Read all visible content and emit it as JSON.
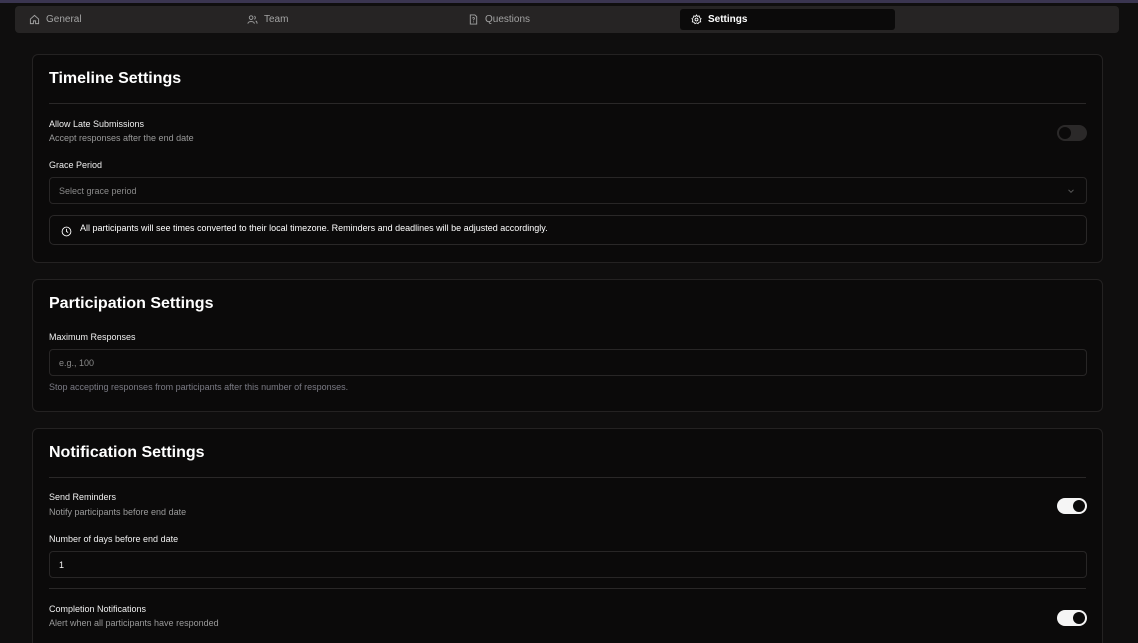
{
  "tabs": [
    {
      "label": "General",
      "icon": "home-icon",
      "active": false
    },
    {
      "label": "Team",
      "icon": "users-icon",
      "active": false
    },
    {
      "label": "Questions",
      "icon": "file-question-icon",
      "active": false
    },
    {
      "label": "Settings",
      "icon": "gear-icon",
      "active": true
    }
  ],
  "timeline": {
    "title": "Timeline Settings",
    "late": {
      "label": "Allow Late Submissions",
      "description": "Accept responses after the end date",
      "enabled": false
    },
    "grace": {
      "label": "Grace Period",
      "placeholder": "Select grace period"
    },
    "info": "All participants will see times converted to their local timezone. Reminders and deadlines will be adjusted accordingly."
  },
  "participation": {
    "title": "Participation Settings",
    "max": {
      "label": "Maximum Responses",
      "placeholder": "e.g., 100",
      "help": "Stop accepting responses from participants after this number of responses."
    }
  },
  "notification": {
    "title": "Notification Settings",
    "reminders": {
      "label": "Send Reminders",
      "description": "Notify participants before end date",
      "enabled": true
    },
    "days": {
      "label": "Number of days before end date",
      "value": "1"
    },
    "completion": {
      "label": "Completion Notifications",
      "description": "Alert when all participants have responded",
      "enabled": true
    }
  },
  "colors": {
    "background": "#0f0e0e",
    "card": "#0b0a0a",
    "toggle_on": "#f5f5f5",
    "toggle_off": "#2b2929"
  }
}
